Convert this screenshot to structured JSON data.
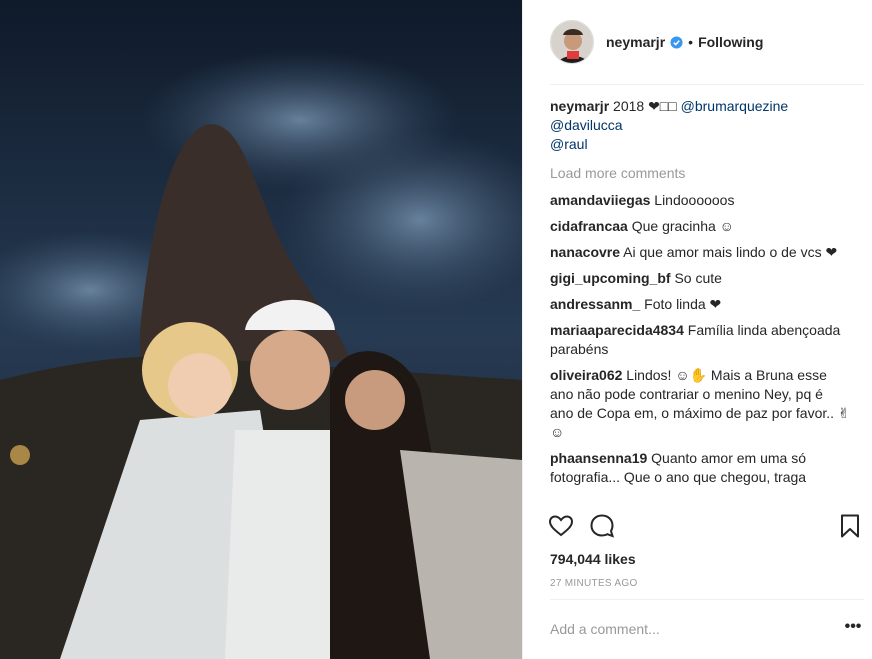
{
  "header": {
    "username": "neymarjr",
    "verified_icon": "verified-badge-icon",
    "separator": "•",
    "follow_status": "Following"
  },
  "caption": {
    "user": "neymarjr",
    "text": "2018 ❤︎□□",
    "mentions": [
      "@brumarquezine",
      "@davilucca",
      "@raul"
    ]
  },
  "load_more": "Load more comments",
  "comments": [
    {
      "user": "amandaviiegas",
      "text": "Lindoooooos"
    },
    {
      "user": "cidafrancaa",
      "text": "Que gracinha ☺"
    },
    {
      "user": "nanacovre",
      "text": "Ai que amor mais lindo o de vcs ❤"
    },
    {
      "user": "gigi_upcoming_bf",
      "text": "So cute"
    },
    {
      "user": "andressanm_",
      "text": "Foto linda ❤"
    },
    {
      "user": "mariaaparecida4834",
      "text": "Família linda abençoada parabéns"
    },
    {
      "user": "oliveira062",
      "text": "Lindos! ☺✋ Mais a Bruna esse ano não pode contrariar o menino Ney, pq é ano de Copa em, o máximo de paz por favor.. ✌☺"
    },
    {
      "user": "phaansenna19",
      "text": "Quanto amor em uma só fotografia... Que o ano que chegou, traga"
    }
  ],
  "likes": "794,044 likes",
  "time": "27 MINUTES AGO",
  "add_comment_placeholder": "Add a comment...",
  "more_options": "•••",
  "colors": {
    "mention": "#003569",
    "verified": "#3897f0",
    "muted": "#999999"
  }
}
